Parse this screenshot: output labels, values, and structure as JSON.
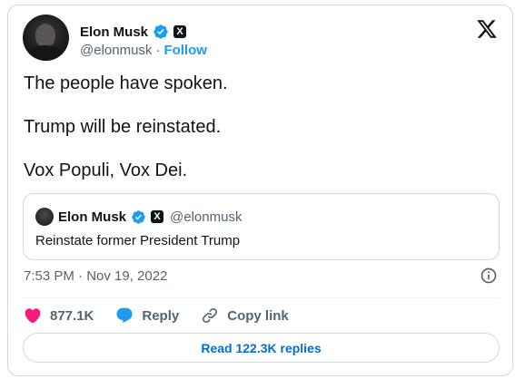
{
  "author": {
    "name": "Elon Musk",
    "handle": "@elonmusk",
    "separator": "·",
    "follow_label": "Follow",
    "verified_badge_color": "#1d9bf0",
    "affiliation_badge": "X"
  },
  "tweet": {
    "lines": [
      "The people have spoken.",
      "Trump will be reinstated.",
      "Vox Populi, Vox Dei."
    ],
    "timestamp": "7:53 PM · Nov 19, 2022"
  },
  "quoted_tweet": {
    "name": "Elon Musk",
    "handle": "@elonmusk",
    "text": "Reinstate former President Trump"
  },
  "actions": {
    "likes": "877.1K",
    "reply_label": "Reply",
    "copy_link_label": "Copy link",
    "like_color": "#f91880",
    "reply_color": "#1d9bf0"
  },
  "read_replies_label": "Read 122.3K replies",
  "icons": {
    "logo": "x-logo-icon",
    "verified": "verified-badge-icon",
    "info": "info-icon",
    "like": "heart-icon",
    "reply": "reply-bubble-icon",
    "copy_link": "link-icon"
  }
}
